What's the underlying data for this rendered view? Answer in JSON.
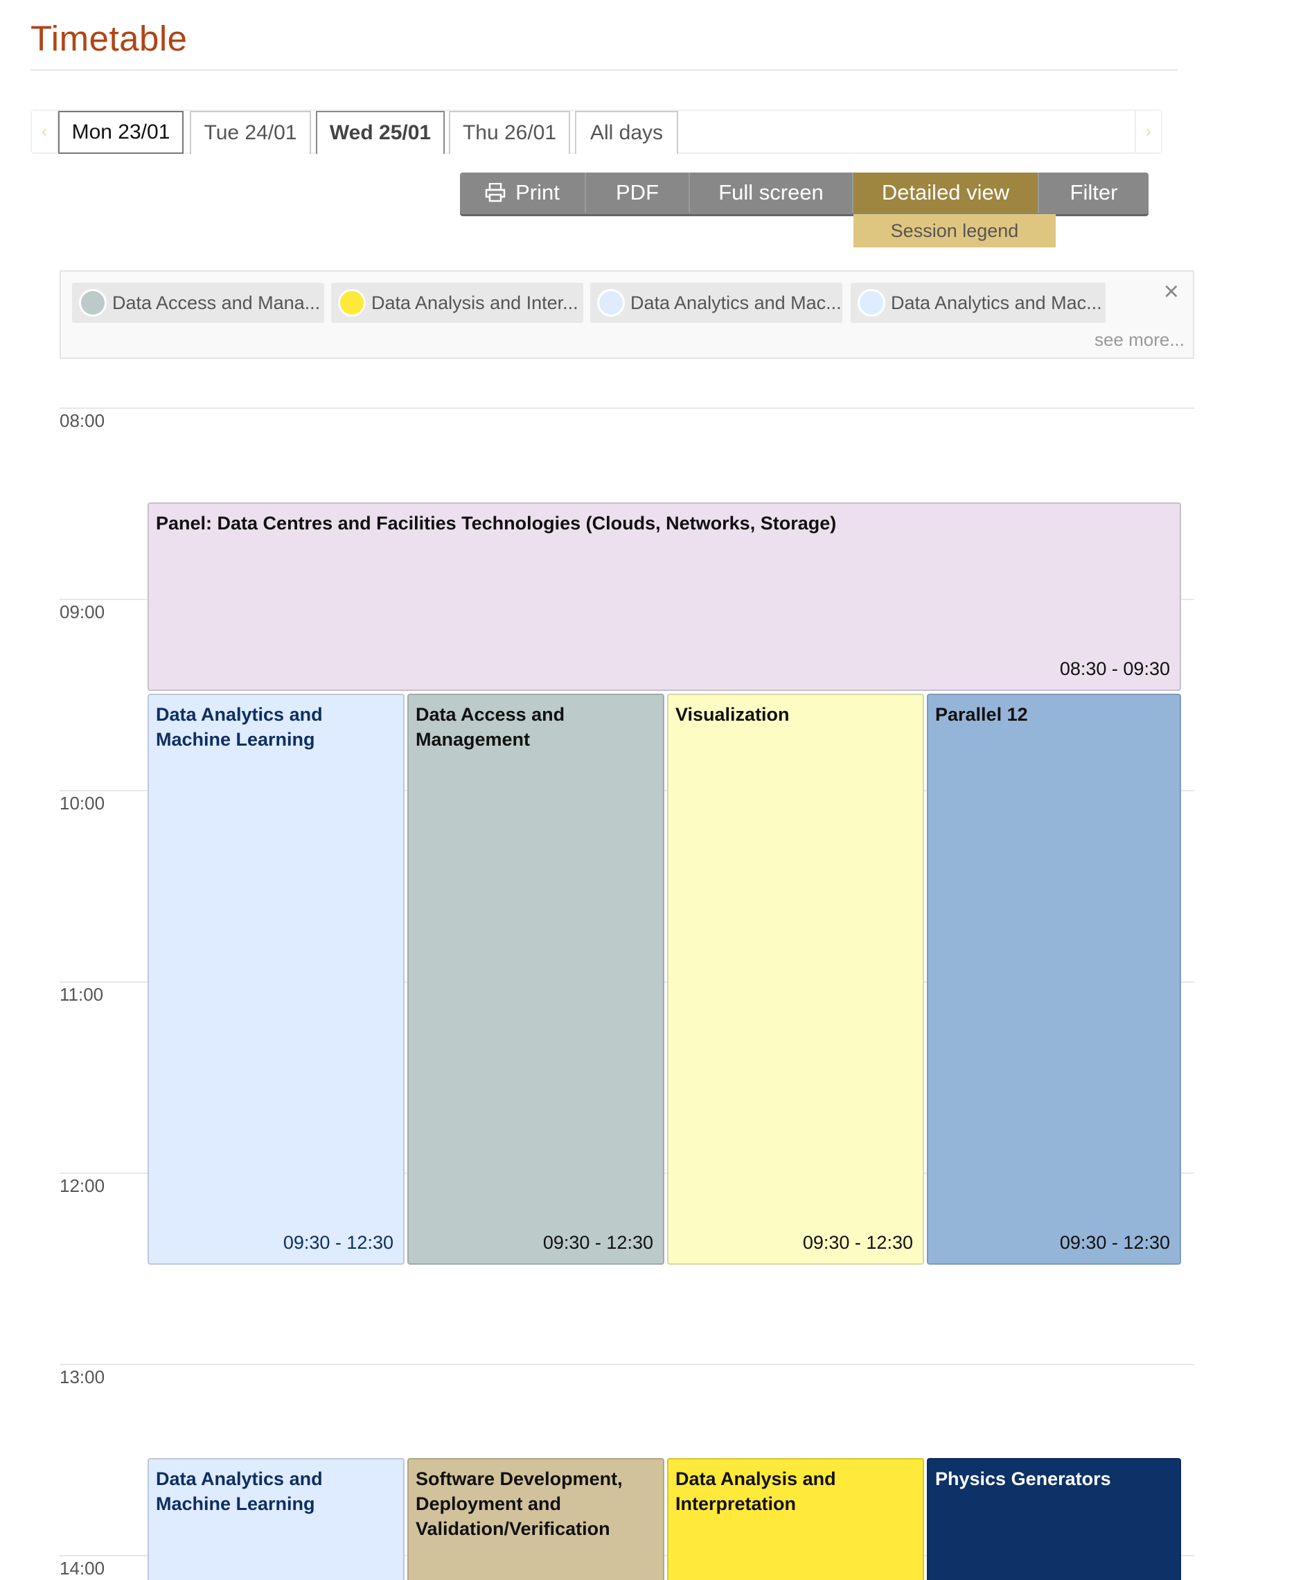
{
  "page": {
    "title": "Timetable"
  },
  "tabs": {
    "prev_arrow": "‹",
    "next_arrow": "›",
    "items": [
      {
        "label": "Mon 23/01"
      },
      {
        "label": "Tue 24/01"
      },
      {
        "label": "Wed 25/01"
      },
      {
        "label": "Thu 26/01"
      },
      {
        "label": "All days"
      }
    ]
  },
  "toolbar": {
    "print": "Print",
    "pdf": "PDF",
    "fullscreen": "Full screen",
    "detailed": "Detailed view",
    "filter": "Filter",
    "session_legend": "Session legend"
  },
  "legend": {
    "close": "×",
    "see_more": "see more...",
    "items": [
      {
        "label": "Data Access and Mana...",
        "color": "#bccac9"
      },
      {
        "label": "Data Analysis and Inter...",
        "color": "#ffe93b"
      },
      {
        "label": "Data Analytics and Mac...",
        "color": "#dfebff"
      },
      {
        "label": "Data Analytics and Mac...",
        "color": "#dfebff"
      }
    ]
  },
  "hours": [
    "08:00",
    "09:00",
    "10:00",
    "11:00",
    "12:00",
    "13:00",
    "14:00"
  ],
  "blocks": {
    "panel": {
      "title": "Panel: Data Centres and Facilities Technologies (Clouds, Networks, Storage)",
      "time": "08:30 - 09:30",
      "color": "#ece0ee"
    },
    "morning": [
      {
        "title": "Data Analytics and Machine Learning",
        "time": "09:30 - 12:30",
        "color": "#dfebff",
        "text_color": "#0d2f61"
      },
      {
        "title": "Data Access and Management",
        "time": "09:30 - 12:30",
        "color": "#bccac9",
        "text_color": "#111111"
      },
      {
        "title": "Visualization",
        "time": "09:30 - 12:30",
        "color": "#fdfdc3",
        "text_color": "#111111"
      },
      {
        "title": "Parallel 12",
        "time": "09:30 - 12:30",
        "color": "#95b5d8",
        "text_color": "#111111"
      }
    ],
    "afternoon": [
      {
        "title": "Data Analytics and Machine Learning",
        "color": "#dfebff",
        "text_color": "#0d2f61"
      },
      {
        "title": "Software Development, Deployment and Validation/Verification",
        "color": "#d1c29c",
        "text_color": "#111111"
      },
      {
        "title": "Data Analysis and Interpretation",
        "color": "#ffe93b",
        "text_color": "#111111"
      },
      {
        "title": "Physics Generators",
        "color": "#0d3268",
        "text_color": "#ffffff"
      }
    ]
  }
}
